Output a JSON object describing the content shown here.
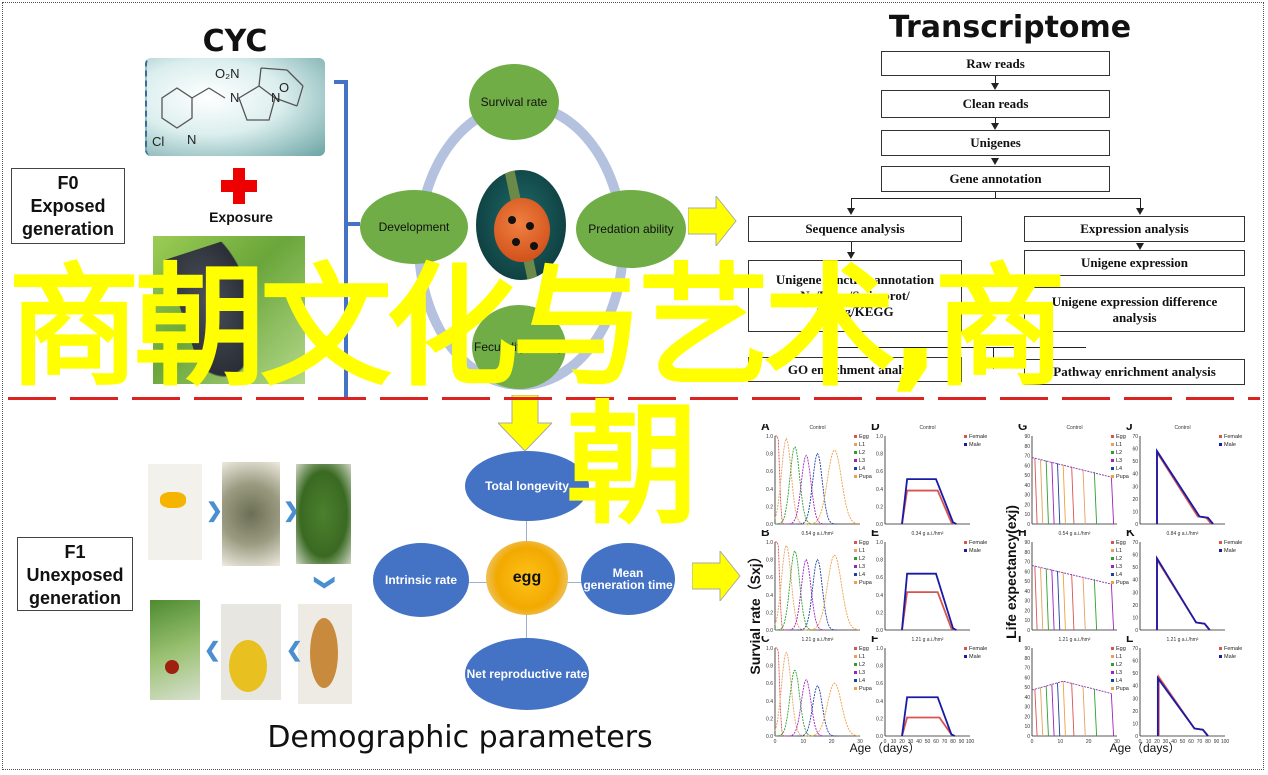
{
  "left": {
    "cyc_title": "CYC",
    "exposure_label": "Exposure",
    "f0_box": [
      "F0",
      "Exposed",
      "generation"
    ],
    "f1_box": [
      "F1",
      "Unexposed",
      "generation"
    ],
    "molecule_labels": {
      "no2": "O₂N",
      "n1": "N",
      "n2": "N",
      "o": "O",
      "cl": "Cl",
      "n3": "N"
    }
  },
  "traits_cycle": {
    "center_image": "ladybug",
    "nodes": [
      "Survival rate",
      "Development",
      "Predation ability",
      "Fecundity fertility"
    ]
  },
  "demographic": {
    "title": "Demographic parameters",
    "center_label": "egg",
    "nodes": [
      "Total longevity",
      "Intrinsic rate",
      "Mean generation time",
      "Net reproductive rate"
    ]
  },
  "transcriptome": {
    "title": "Transcriptome",
    "steps": [
      "Raw reads",
      "Clean reads",
      "Unigenes",
      "Gene annotation"
    ],
    "left_branch": [
      "Sequence analysis",
      "Unigene function annotation",
      "Nr/Pfam/Swissprot/",
      "String/KEGG"
    ],
    "right_branch": [
      "Expression analysis",
      "Unigene expression",
      "Unigene expression difference",
      "analysis"
    ],
    "bottom": [
      "GO enrichment analysis",
      "Pathway enrichment analysis"
    ]
  },
  "overlay": {
    "line1": "商朝文化与艺术,商",
    "line2": "朝",
    "color": "#ffff00"
  },
  "chart_data": [
    {
      "type": "line",
      "panel": "A",
      "title": "Control",
      "xlabel": "",
      "ylabel": "",
      "ylim": [
        0,
        1.0
      ],
      "xlim": [
        0,
        30
      ],
      "yticks": [
        "0.0",
        "0.2",
        "0.4",
        "0.6",
        "0.8",
        "1.0"
      ],
      "series": [
        {
          "name": "Egg",
          "color": "#d9534f",
          "peak_x": 1,
          "peak_y": 1.0
        },
        {
          "name": "L1",
          "color": "#e8a060",
          "peak_x": 4,
          "peak_y": 0.97
        },
        {
          "name": "L2",
          "color": "#2ca02c",
          "peak_x": 7,
          "peak_y": 0.88
        },
        {
          "name": "L3",
          "color": "#a020c0",
          "peak_x": 11,
          "peak_y": 0.78
        },
        {
          "name": "L4",
          "color": "#1f3fa0",
          "peak_x": 15,
          "peak_y": 0.8
        },
        {
          "name": "Pupa",
          "color": "#f0a040",
          "peak_x": 21,
          "peak_y": 0.84
        }
      ]
    },
    {
      "type": "line",
      "panel": "B",
      "title": "0.54 g a.i./hm²",
      "ylim": [
        0,
        1.0
      ],
      "xlim": [
        0,
        30
      ],
      "yticks": [
        "0.0",
        "0.2",
        "0.4",
        "0.6",
        "0.8",
        "1.0"
      ],
      "series": [
        {
          "name": "Egg",
          "color": "#d9534f",
          "peak_x": 1,
          "peak_y": 1.0
        },
        {
          "name": "L1",
          "color": "#e8a060",
          "peak_x": 4,
          "peak_y": 0.96
        },
        {
          "name": "L2",
          "color": "#2ca02c",
          "peak_x": 7,
          "peak_y": 0.9
        },
        {
          "name": "L3",
          "color": "#a020c0",
          "peak_x": 11,
          "peak_y": 0.8
        },
        {
          "name": "L4",
          "color": "#1f3fa0",
          "peak_x": 15,
          "peak_y": 0.8
        },
        {
          "name": "Pupa",
          "color": "#f0a040",
          "peak_x": 21,
          "peak_y": 0.85
        }
      ]
    },
    {
      "type": "line",
      "panel": "C",
      "title": "1.21 g a.i./hm²",
      "ylim": [
        0,
        1.0
      ],
      "xlim": [
        0,
        30
      ],
      "yticks": [
        "0.0",
        "0.2",
        "0.4",
        "0.6",
        "0.8",
        "1.0"
      ],
      "xticks": [
        "0",
        "10",
        "20",
        "30"
      ],
      "series": [
        {
          "name": "Egg",
          "color": "#d9534f",
          "peak_x": 1,
          "peak_y": 1.0
        },
        {
          "name": "L1",
          "color": "#e8a060",
          "peak_x": 4,
          "peak_y": 0.95
        },
        {
          "name": "L2",
          "color": "#2ca02c",
          "peak_x": 7,
          "peak_y": 0.75
        },
        {
          "name": "L3",
          "color": "#a020c0",
          "peak_x": 11,
          "peak_y": 0.64
        },
        {
          "name": "L4",
          "color": "#1f3fa0",
          "peak_x": 15,
          "peak_y": 0.57
        },
        {
          "name": "Pupa",
          "color": "#f0a040",
          "peak_x": 21,
          "peak_y": 0.6
        }
      ]
    },
    {
      "type": "line",
      "panel": "D",
      "title": "Control",
      "ylim": [
        0,
        1.0
      ],
      "xlim": [
        0,
        100
      ],
      "yticks": [
        "0.0",
        "0.2",
        "0.4",
        "0.6",
        "0.8",
        "1.0"
      ],
      "series": [
        {
          "name": "Female",
          "color": "#d9534f",
          "plateau": 0.38,
          "start": 20,
          "end": 62,
          "finish": 78
        },
        {
          "name": "Male",
          "color": "#1a1aa8",
          "plateau": 0.51,
          "start": 20,
          "end": 60,
          "finish": 80
        }
      ]
    },
    {
      "type": "line",
      "panel": "E",
      "title": "0.34 g a.i./hm²",
      "ylim": [
        0,
        1.0
      ],
      "xlim": [
        0,
        100
      ],
      "yticks": [
        "0.0",
        "0.2",
        "0.4",
        "0.6",
        "0.8",
        "1.0"
      ],
      "series": [
        {
          "name": "Female",
          "color": "#d9534f",
          "plateau": 0.43,
          "start": 20,
          "end": 62,
          "finish": 78
        },
        {
          "name": "Male",
          "color": "#1a1aa8",
          "plateau": 0.64,
          "start": 20,
          "end": 60,
          "finish": 80
        }
      ]
    },
    {
      "type": "line",
      "panel": "F",
      "title": "1.21 g a.i./hm²",
      "ylim": [
        0,
        1.0
      ],
      "xlim": [
        0,
        100
      ],
      "yticks": [
        "0.0",
        "0.2",
        "0.4",
        "0.6",
        "0.8",
        "1.0"
      ],
      "xticks": [
        "0",
        "10",
        "20",
        "30",
        "40",
        "50",
        "60",
        "70",
        "80",
        "90",
        "100"
      ],
      "series": [
        {
          "name": "Female",
          "color": "#d9534f",
          "plateau": 0.21,
          "start": 20,
          "end": 64,
          "finish": 78
        },
        {
          "name": "Male",
          "color": "#1a1aa8",
          "plateau": 0.44,
          "start": 20,
          "end": 62,
          "finish": 78
        }
      ]
    },
    {
      "type": "line",
      "panel": "G",
      "title": "Control",
      "ylim": [
        0,
        90
      ],
      "xlim": [
        0,
        30
      ],
      "yticks": [
        "0",
        "10",
        "20",
        "30",
        "40",
        "50",
        "60",
        "70",
        "80",
        "90"
      ],
      "series_names": [
        "Egg",
        "L1",
        "L2",
        "L3",
        "L4",
        "Pupa"
      ],
      "trend": {
        "start": 68,
        "end": 48
      }
    },
    {
      "type": "line",
      "panel": "H",
      "title": "0.54 g a.i./hm²",
      "ylim": [
        0,
        90
      ],
      "xlim": [
        0,
        30
      ],
      "yticks": [
        "0",
        "10",
        "20",
        "30",
        "40",
        "50",
        "60",
        "70",
        "80",
        "90"
      ],
      "series_names": [
        "Egg",
        "L1",
        "L2",
        "L3",
        "L4",
        "Pupa"
      ],
      "trend": {
        "start": 66,
        "end": 47
      }
    },
    {
      "type": "line",
      "panel": "I",
      "title": "1.21 g a.i./hm²",
      "ylim": [
        0,
        90
      ],
      "xlim": [
        0,
        30
      ],
      "yticks": [
        "0",
        "10",
        "20",
        "30",
        "40",
        "50",
        "60",
        "70",
        "80",
        "90"
      ],
      "xticks": [
        "0",
        "10",
        "20",
        "30"
      ],
      "series_names": [
        "Egg",
        "L1",
        "L2",
        "L3",
        "L4",
        "Pupa"
      ],
      "trend": {
        "start": 47,
        "peak": 56,
        "end": 42
      }
    },
    {
      "type": "line",
      "panel": "J",
      "title": "Control",
      "ylim": [
        0,
        70
      ],
      "xlim": [
        0,
        100
      ],
      "yticks": [
        "0",
        "10",
        "20",
        "30",
        "40",
        "50",
        "60",
        "70"
      ],
      "series": [
        {
          "name": "Female",
          "color": "#d9534f",
          "start_x": 20,
          "start_y": 57,
          "end_x": 84
        },
        {
          "name": "Male",
          "color": "#1a1aa8",
          "start_x": 20,
          "start_y": 58,
          "end_x": 86
        }
      ]
    },
    {
      "type": "line",
      "panel": "K",
      "title": "0.84 g a.i./hm²",
      "ylim": [
        0,
        70
      ],
      "xlim": [
        0,
        100
      ],
      "yticks": [
        "0",
        "10",
        "20",
        "30",
        "40",
        "50",
        "60",
        "70"
      ],
      "series": [
        {
          "name": "Female",
          "color": "#d9534f",
          "start_x": 20,
          "start_y": 56,
          "end_x": 82
        },
        {
          "name": "Male",
          "color": "#1a1aa8",
          "start_x": 20,
          "start_y": 57,
          "end_x": 82
        }
      ]
    },
    {
      "type": "line",
      "panel": "L",
      "title": "1.21 g a.i./hm²",
      "ylim": [
        0,
        70
      ],
      "xlim": [
        0,
        100
      ],
      "yticks": [
        "0",
        "10",
        "20",
        "30",
        "40",
        "50",
        "60",
        "70"
      ],
      "xticks": [
        "0",
        "10",
        "20",
        "30",
        "40",
        "50",
        "60",
        "70",
        "80",
        "90",
        "100"
      ],
      "series": [
        {
          "name": "Female",
          "color": "#d9534f",
          "start_x": 22,
          "start_y": 47,
          "end_x": 80
        },
        {
          "name": "Male",
          "color": "#1a1aa8",
          "start_x": 21,
          "start_y": 46,
          "end_x": 80
        }
      ]
    }
  ],
  "chart_labels": {
    "survival_ylabel": "Survial rate（Sxj）",
    "life_ylabel": "Life expectancy(exj)",
    "xlabel": "Age（days）"
  }
}
